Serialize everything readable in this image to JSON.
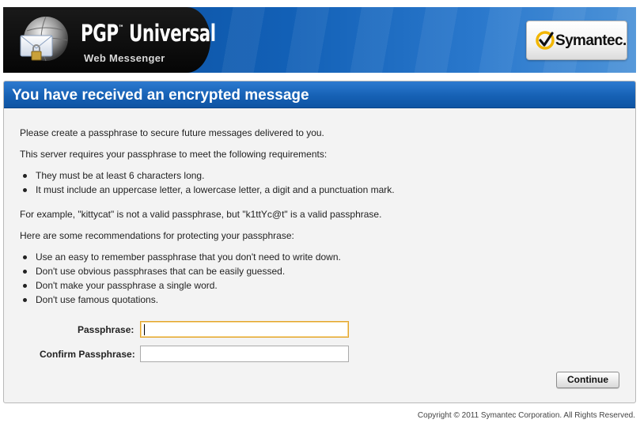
{
  "header": {
    "brand_title": "PGP",
    "brand_title_mark": "™",
    "brand_title_rest": " Universal",
    "brand_subtitle": "Web Messenger",
    "partner_logo": "Symantec.",
    "logo_icon": "envelope-globe-lock-icon",
    "partner_icon": "symantec-check-icon",
    "colors": {
      "banner_blue": "#1260b6",
      "banner_dark": "#0a0a0a",
      "check_yellow": "#f2b600"
    }
  },
  "panel": {
    "title": "You have received an encrypted message",
    "intro": "Please create a passphrase to secure future messages delivered to you.",
    "requirements_intro": "This server requires your passphrase to meet the following requirements:",
    "requirements": [
      "They must be at least 6 characters long.",
      "It must include an uppercase letter, a lowercase letter, a digit and a punctuation mark."
    ],
    "example": "For example, \"kittycat\" is not a valid passphrase, but \"k1ttYc@t\" is a valid passphrase.",
    "recommendations_intro": "Here are some recommendations for protecting your passphrase:",
    "recommendations": [
      "Use an easy to remember passphrase that you don't need to write down.",
      "Don't use obvious passphrases that can be easily guessed.",
      "Don't make your passphrase a single word.",
      "Don't use famous quotations."
    ]
  },
  "form": {
    "passphrase_label": "Passphrase:",
    "passphrase_value": "",
    "confirm_label": "Confirm Passphrase:",
    "confirm_value": "",
    "continue_label": "Continue"
  },
  "footer": {
    "copyright": "Copyright © 2011 Symantec Corporation. All Rights Reserved."
  }
}
